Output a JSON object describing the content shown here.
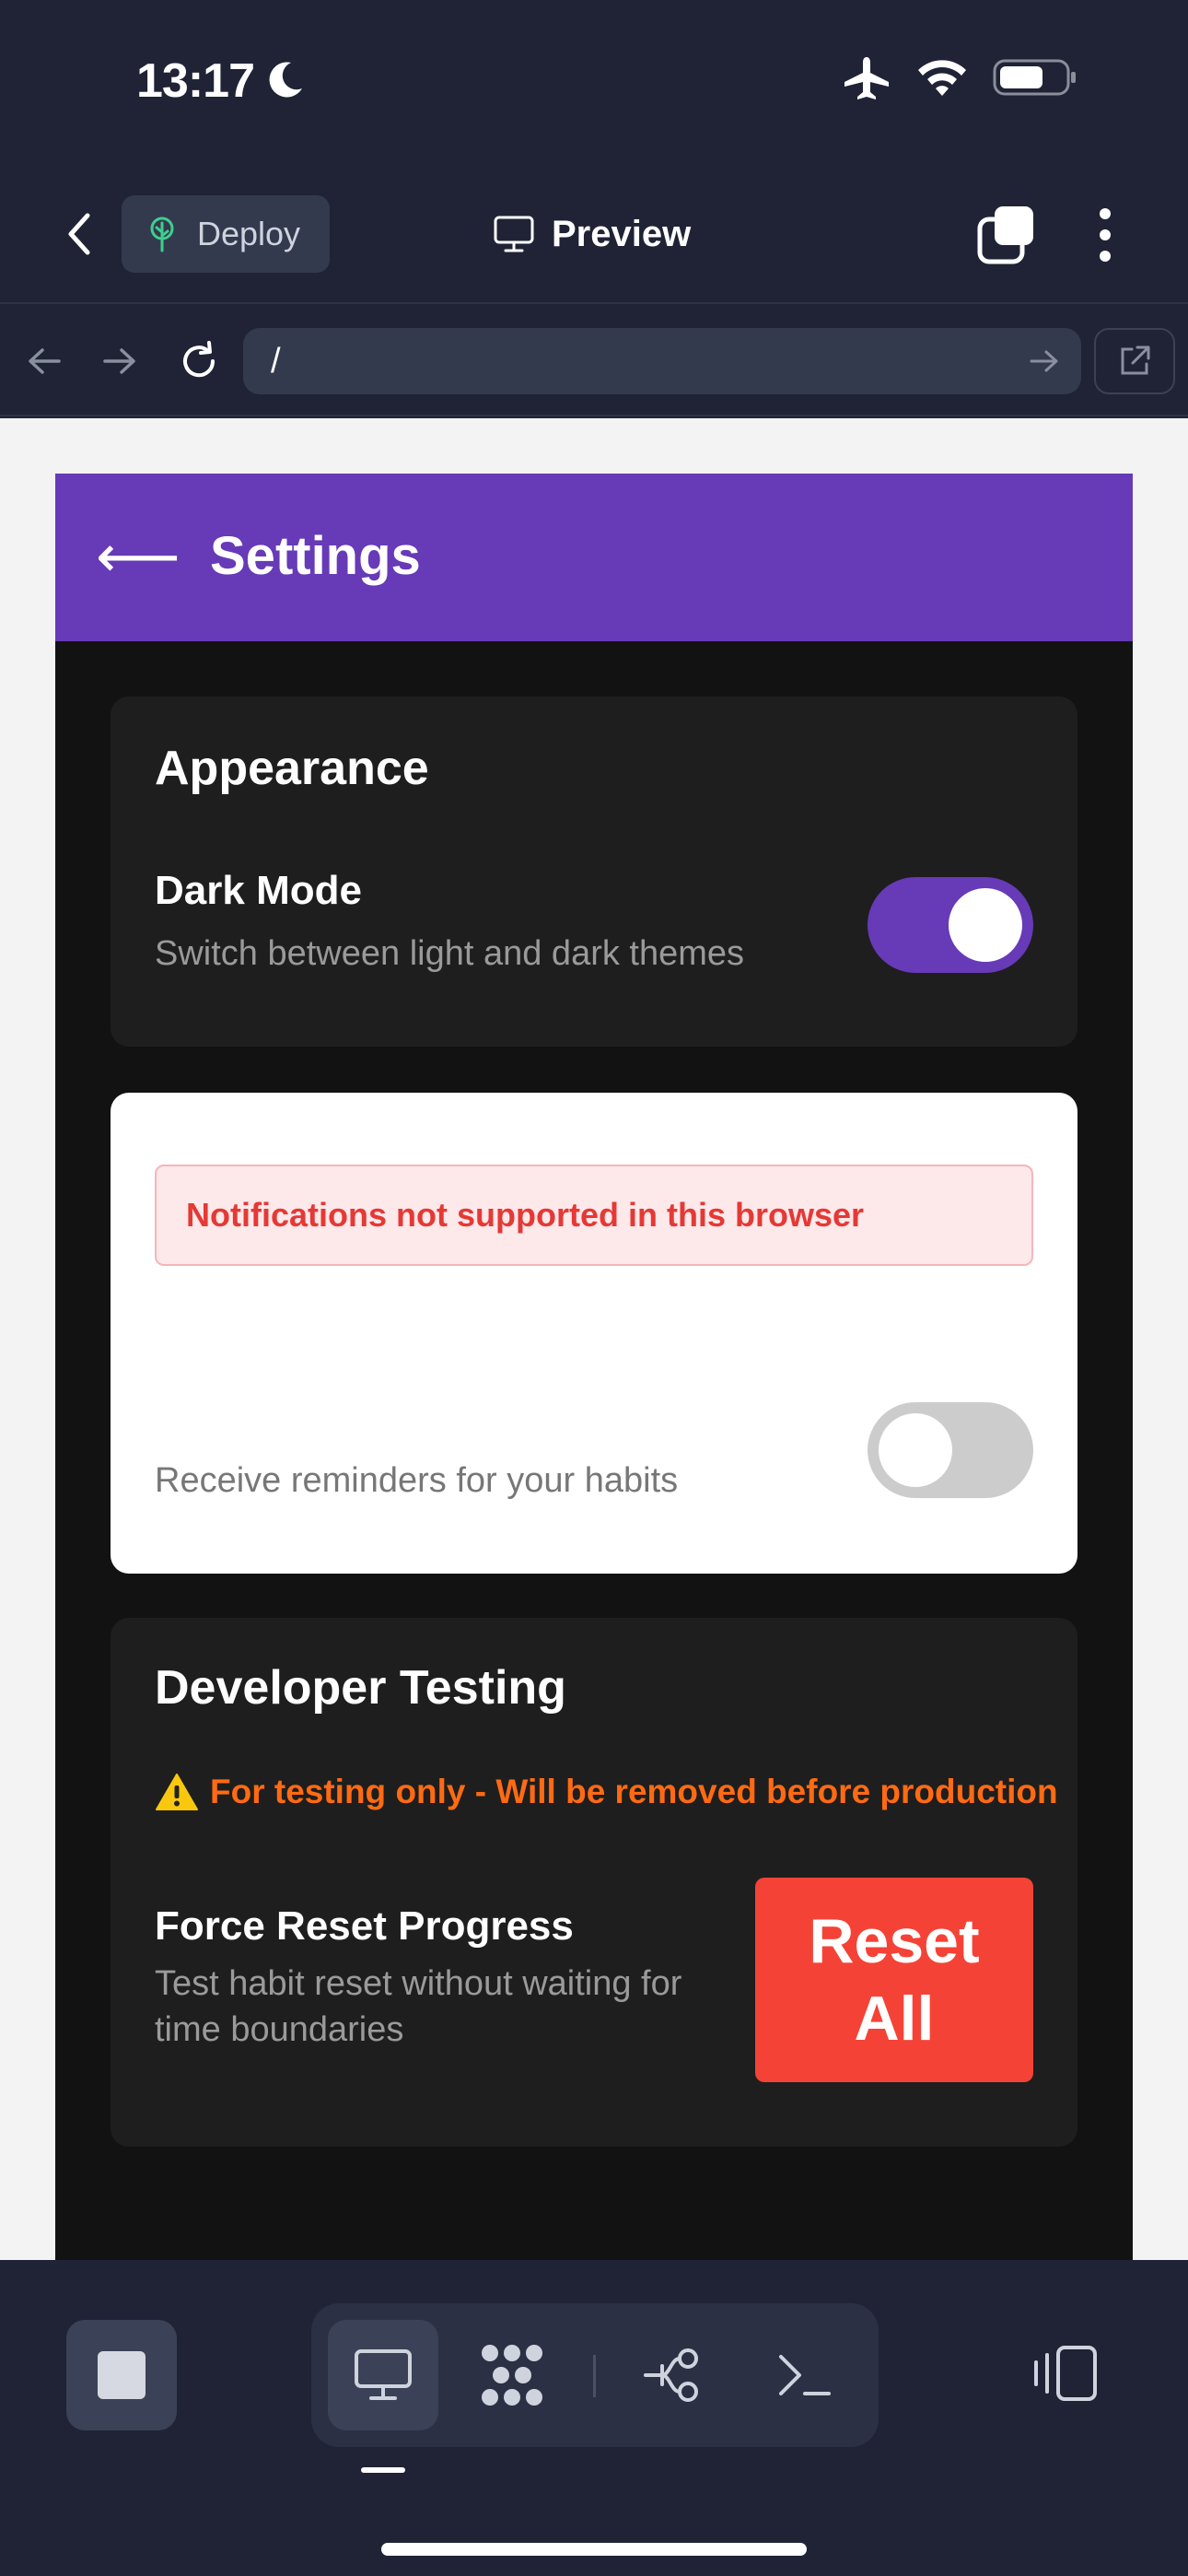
{
  "status_bar": {
    "time": "13:17"
  },
  "toolbar": {
    "deploy_label": "Deploy",
    "preview_label": "Preview"
  },
  "browser": {
    "url": "/"
  },
  "app": {
    "header_back": "⟵",
    "header_title": "Settings",
    "appearance": {
      "title": "Appearance",
      "dark_mode_label": "Dark Mode",
      "dark_mode_desc": "Switch between light and dark themes",
      "dark_mode_on": true
    },
    "notifications": {
      "error": "Notifications not supported in this browser",
      "desc": "Receive reminders for your habits",
      "enabled": false
    },
    "developer": {
      "title": "Developer Testing",
      "warning": "For testing only - Will be removed before production",
      "reset_label": "Force Reset Progress",
      "reset_desc": "Test habit reset without waiting for time boundaries",
      "reset_button": "Reset All"
    }
  },
  "colors": {
    "accent": "#673ab7",
    "danger": "#f44336",
    "warning": "#ff6a13",
    "chrome_bg": "#1f2335"
  }
}
